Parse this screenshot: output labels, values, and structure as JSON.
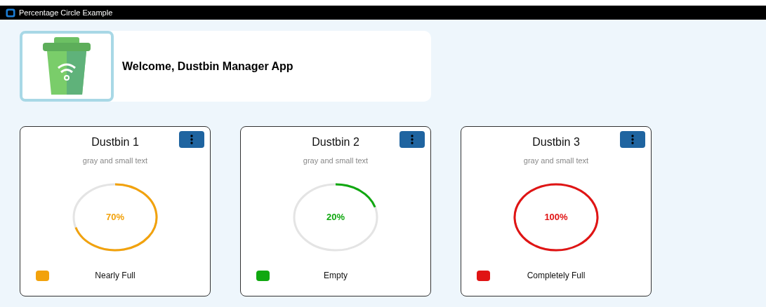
{
  "window": {
    "title": "Percentage Circle Example"
  },
  "header": {
    "welcome": "Welcome, Dustbin Manager App"
  },
  "bins": [
    {
      "name": "Dustbin 1",
      "subtitle": "gray and small text",
      "percent": "70%",
      "color": "#f2a20c",
      "status": "Nearly Full"
    },
    {
      "name": "Dustbin 2",
      "subtitle": "gray and small text",
      "percent": "20%",
      "color": "#10a810",
      "status": "Empty"
    },
    {
      "name": "Dustbin 3",
      "subtitle": "gray and small text",
      "percent": "100%",
      "color": "#e01414",
      "status": "Completely Full"
    }
  ]
}
